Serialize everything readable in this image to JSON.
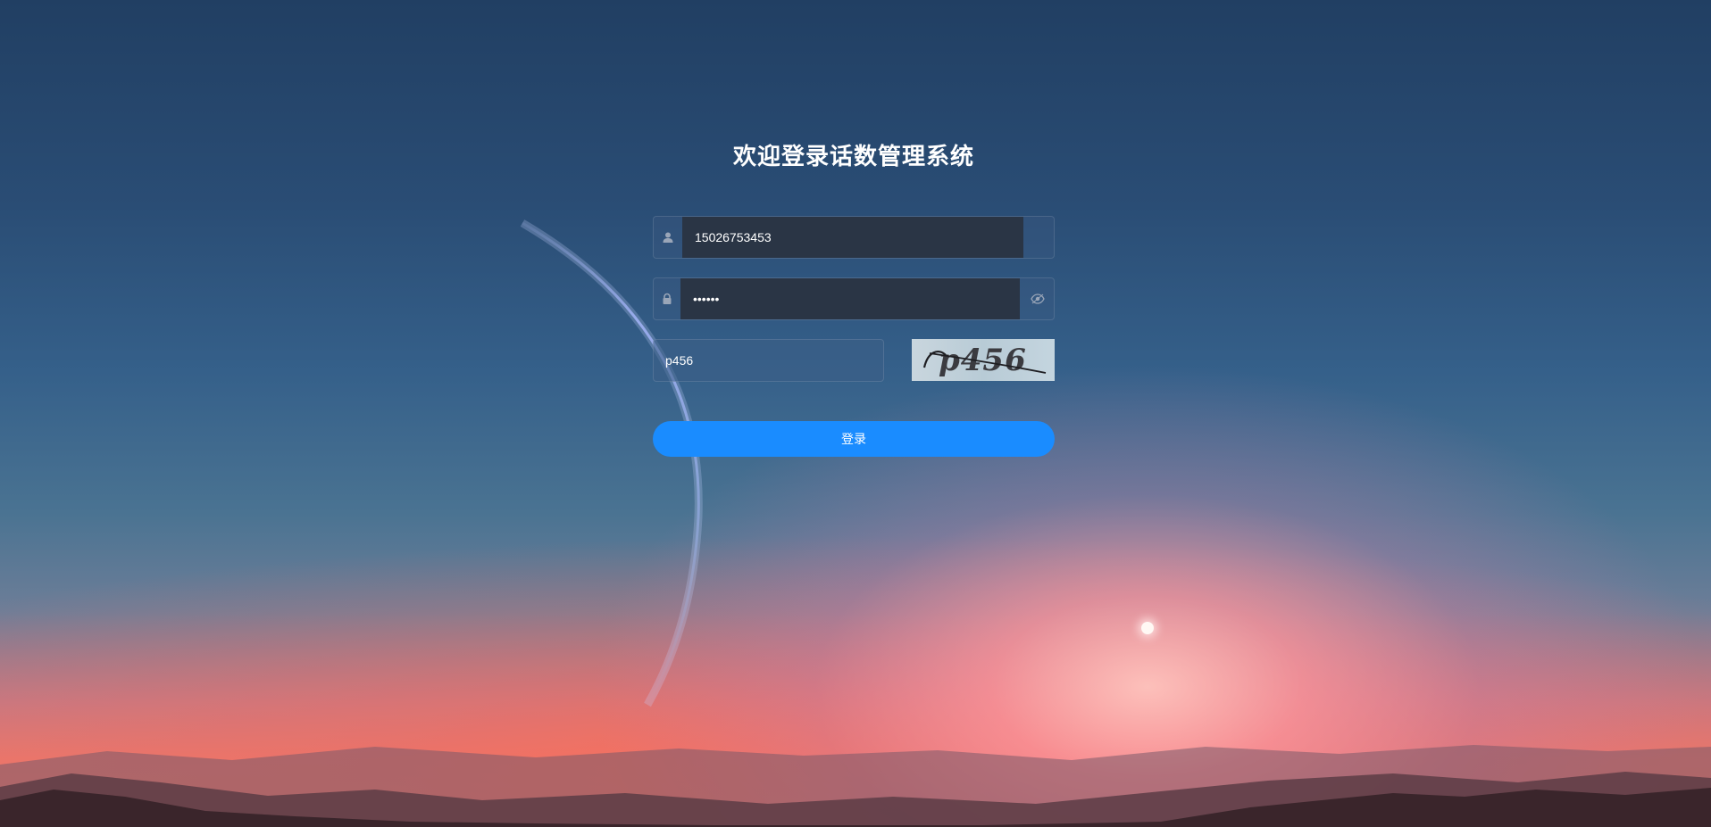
{
  "login": {
    "title": "欢迎登录话数管理系统",
    "username": {
      "value": "15026753453",
      "icon": "user-icon"
    },
    "password": {
      "value": "••••••",
      "icon": "lock-icon",
      "toggle_icon": "eye-icon"
    },
    "captcha": {
      "value": "p456",
      "image_text": "p456"
    },
    "submit_label": "登录"
  },
  "colors": {
    "primary": "#1a8cff",
    "input_bg": "#2a3545",
    "sky_top": "#213f63",
    "horizon_glow": "#f07a66"
  }
}
